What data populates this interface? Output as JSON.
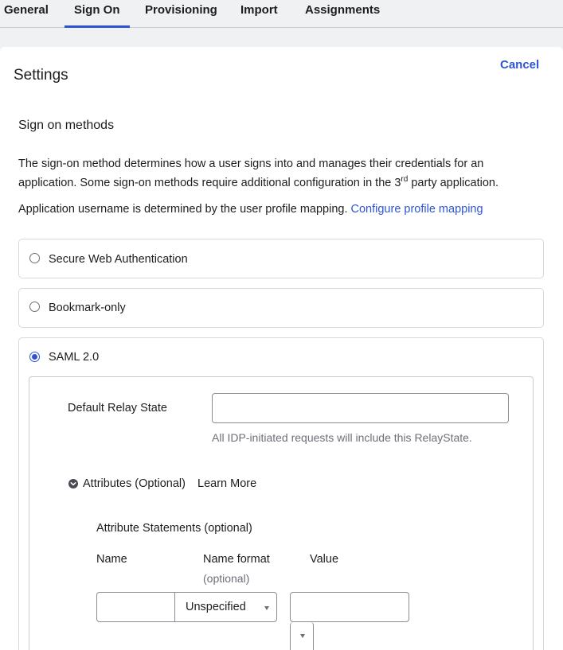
{
  "tabs": [
    {
      "label": "General"
    },
    {
      "label": "Sign On"
    },
    {
      "label": "Provisioning"
    },
    {
      "label": "Import"
    },
    {
      "label": "Assignments"
    }
  ],
  "active_tab": "Sign On",
  "cancel_label": "Cancel",
  "settings_title": "Settings",
  "sign_on": {
    "title": "Sign on methods",
    "desc_part1": "The sign-on method determines how a user signs into and manages their credentials for an application. Some sign-on methods require additional configuration in the 3",
    "desc_sup": "rd",
    "desc_part2": " party application.",
    "mapping_text": "Application username is determined by the user profile mapping. ",
    "mapping_link": "Configure profile mapping",
    "methods": [
      {
        "label": "Secure Web Authentication",
        "selected": false
      },
      {
        "label": "Bookmark-only",
        "selected": false
      },
      {
        "label": "SAML 2.0",
        "selected": true
      }
    ]
  },
  "saml": {
    "relay_label": "Default Relay State",
    "relay_value": "",
    "relay_hint": "All IDP-initiated requests will include this RelayState.",
    "attributes_label": "Attributes (Optional)",
    "learn_more": "Learn More",
    "statements_title": "Attribute Statements (optional)",
    "col_name": "Name",
    "col_format": "Name format",
    "col_format_hint": "(optional)",
    "col_value": "Value",
    "name_value": "",
    "format_selected": "Unspecified",
    "value_value": ""
  },
  "colors": {
    "accent": "#2e54d6",
    "text": "#1d1d21",
    "muted": "#6e6e78"
  }
}
